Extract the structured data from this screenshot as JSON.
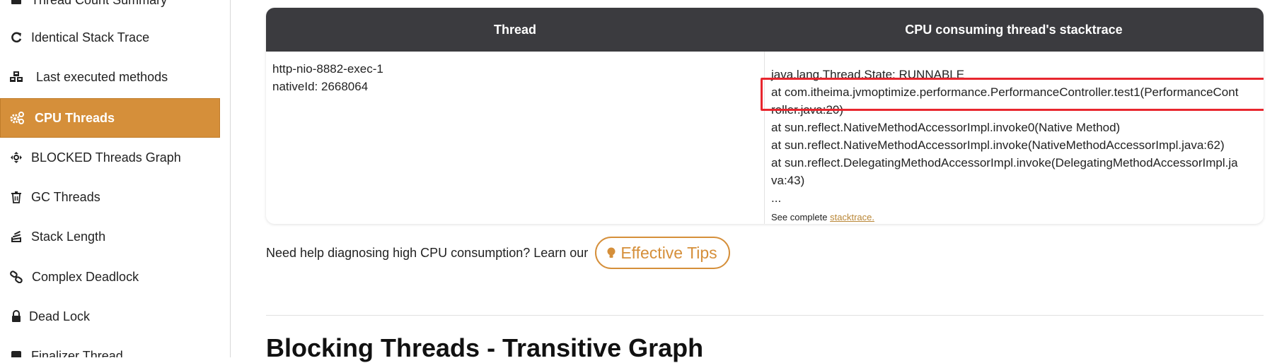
{
  "sidebar": {
    "items": [
      {
        "label": "Thread Count Summary",
        "icon": "stack-icon"
      },
      {
        "label": "Identical Stack Trace",
        "icon": "refresh-icon"
      },
      {
        "label": "Last executed methods",
        "icon": "cubes-icon"
      },
      {
        "label": "CPU Threads",
        "icon": "gears-icon",
        "active": true
      },
      {
        "label": "BLOCKED Threads Graph",
        "icon": "move-icon"
      },
      {
        "label": "GC Threads",
        "icon": "trash-icon"
      },
      {
        "label": "Stack Length",
        "icon": "stack-length-icon"
      },
      {
        "label": "Complex Deadlock",
        "icon": "link-icon"
      },
      {
        "label": "Dead Lock",
        "icon": "lock-icon"
      },
      {
        "label": "Finalizer Thread",
        "icon": "square-icon"
      }
    ],
    "active_color": "#d58f3a"
  },
  "table": {
    "headers": {
      "thread": "Thread",
      "stacktrace": "CPU consuming thread's stacktrace"
    },
    "row": {
      "thread_name": "http-nio-8882-exec-1",
      "native_id": "nativeId: 2668064",
      "stack_lines": [
        "java.lang.Thread.State: RUNNABLE",
        "at com.itheima.jvmoptimize.performance.PerformanceController.test1(PerformanceCont",
        "roller.java:20)",
        "at sun.reflect.NativeMethodAccessorImpl.invoke0(Native Method)",
        "at sun.reflect.NativeMethodAccessorImpl.invoke(NativeMethodAccessorImpl.java:62)",
        "at sun.reflect.DelegatingMethodAccessorImpl.invoke(DelegatingMethodAccessorImpl.ja",
        "va:43)",
        "..."
      ],
      "see_complete_prefix": "See complete ",
      "see_complete_link": "stacktrace."
    },
    "header_color": "#3b3b3f",
    "highlight_color": "#e8262e"
  },
  "help": {
    "text": "Need help diagnosing high CPU consumption? Learn our",
    "button_label": "Effective Tips"
  },
  "section": {
    "title": "Blocking Threads - Transitive Graph"
  }
}
